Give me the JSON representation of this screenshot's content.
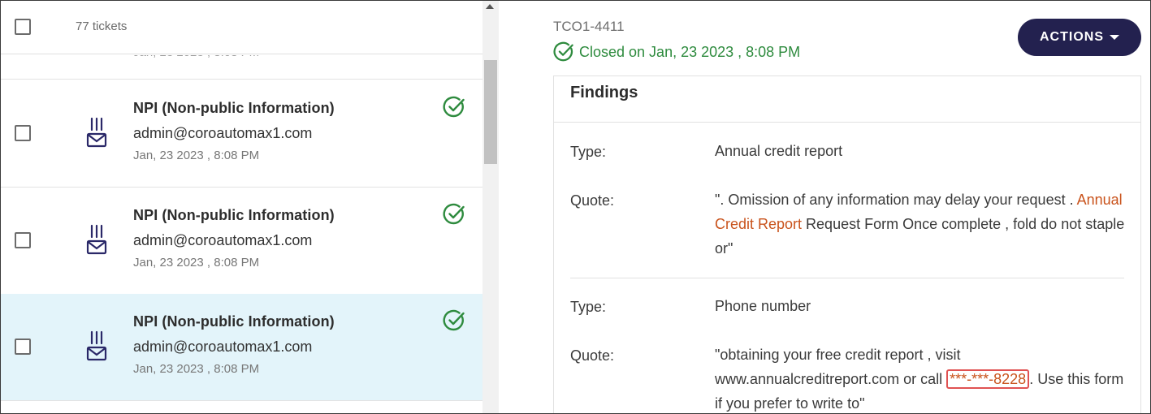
{
  "list": {
    "ticket_count": "77 tickets",
    "tickets": [
      {
        "title": "NPI (Non-public Information)",
        "email": "admin@coroautomax1.com",
        "date": "Jan, 23 2023 , 8:08 PM",
        "selected": false
      },
      {
        "title": "NPI (Non-public Information)",
        "email": "admin@coroautomax1.com",
        "date": "Jan, 23 2023 , 8:08 PM",
        "selected": false
      },
      {
        "title": "NPI (Non-public Information)",
        "email": "admin@coroautomax1.com",
        "date": "Jan, 23 2023 , 8:08 PM",
        "selected": true
      }
    ]
  },
  "detail": {
    "ticket_id": "TCO1-4411",
    "status_text": "Closed on Jan, 23 2023 , 8:08 PM",
    "actions_label": "ACTIONS",
    "findings": {
      "title": "Findings",
      "items": [
        {
          "type_label": "Type:",
          "type_value": "Annual credit report",
          "quote_label": "Quote:",
          "quote_before": "\". Omission of any information may delay your request . ",
          "quote_term": "Annual Credit Report",
          "quote_after": " Request Form Once complete , fold do not staple or\""
        },
        {
          "type_label": "Type:",
          "type_value": "Phone number",
          "quote_label": "Quote:",
          "quote_before": "\"obtaining your free credit report , visit www.annualcreditreport.com or call ",
          "quote_term": "***-***-8228",
          "quote_after": ". Use this form if you prefer to write to\""
        }
      ]
    }
  },
  "colors": {
    "status_green": "#2e8b3e",
    "actions_bg": "#23214f",
    "selected_row_bg": "#e3f4fa",
    "highlight_orange": "#c9531c",
    "mask_border_red": "#e05252"
  },
  "icons": {
    "ticket_type": "mail-stack-icon",
    "resolved": "check-circle-icon"
  }
}
